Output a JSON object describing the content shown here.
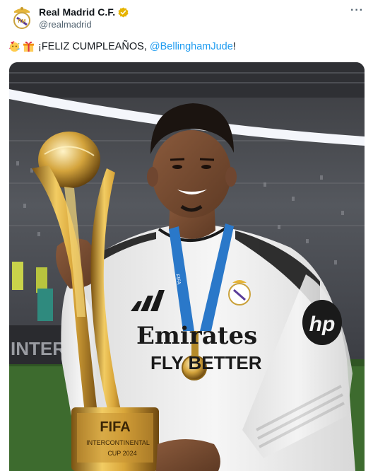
{
  "tweet": {
    "display_name": "Real Madrid C.F.",
    "handle": "@realmadrid",
    "more_label": "···",
    "text_pre": "¡FELIZ CUMPLEAÑOS,",
    "mention": "@BellinghamJude",
    "text_post": "!",
    "emojis": [
      "face-with-party-horn-icon",
      "wrapped-gift-icon"
    ]
  },
  "photo": {
    "shirt_sponsor_line1": "Emirates",
    "shirt_sponsor_line2": "FLY BETTER",
    "sleeve_logo": "hp",
    "board_text": "INTERCO",
    "trophy_text_line1": "FIFA",
    "trophy_text_line2": "INTERCONTINENTAL",
    "trophy_text_line3": "CUP 2024",
    "lanyard_text": "FIFA",
    "colors": {
      "verified": "#e6b400",
      "mention": "#1d9bf0",
      "shirt": "#f4f4f4",
      "gold": "#d9a63a",
      "lanyard": "#2a78c9"
    }
  }
}
